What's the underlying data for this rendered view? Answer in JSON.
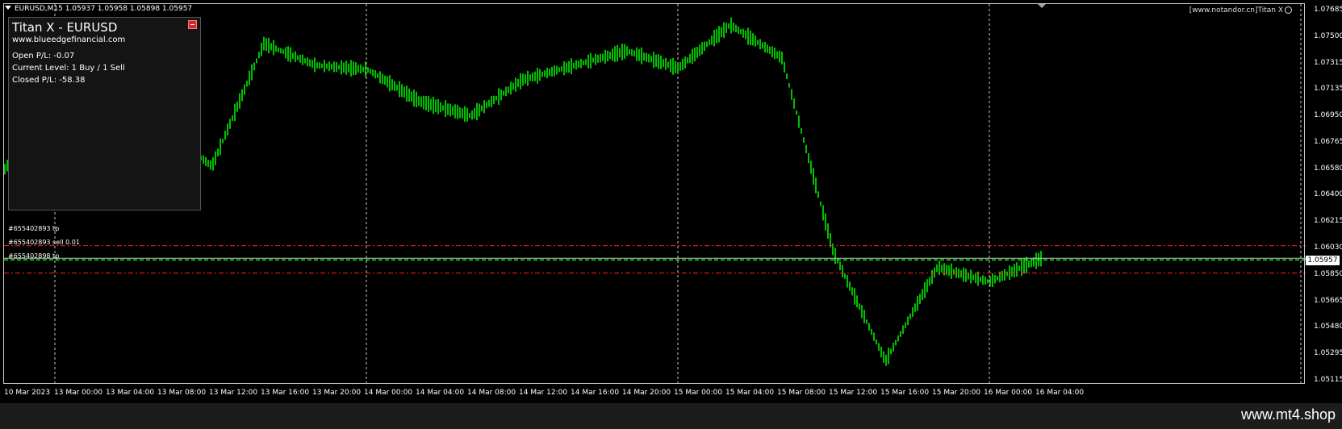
{
  "header": {
    "symbol_line": "EURUSD,M15  1.05937 1.05958 1.05898 1.05957"
  },
  "top_right_label": "[www.notandor.cn]Titan X",
  "panel": {
    "title": "Titan X - EURUSD",
    "website": "www.blueedgefinancial.com",
    "open_pl": "Open P/L: -0.07",
    "current_level": "Current Level: 1 Buy / 1 Sell",
    "closed_pl": "Closed P/L: -58.38"
  },
  "order_labels": {
    "tp_top": "#655402893 tp",
    "entry": "#655402893 sell 0.01",
    "tp_bottom": "#655402898 tp"
  },
  "price_axis": {
    "ticks": [
      "1.07685",
      "1.07500",
      "1.07315",
      "1.07135",
      "1.06950",
      "1.06765",
      "1.06580",
      "1.06400",
      "1.06215",
      "1.06030",
      "1.05850",
      "1.05665",
      "1.05480",
      "1.05295",
      "1.05115"
    ],
    "current_price": "1.05957"
  },
  "time_axis": {
    "ticks": [
      "10 Mar 2023",
      "13 Mar 00:00",
      "13 Mar 04:00",
      "13 Mar 08:00",
      "13 Mar 12:00",
      "13 Mar 16:00",
      "13 Mar 20:00",
      "14 Mar 00:00",
      "14 Mar 04:00",
      "14 Mar 08:00",
      "14 Mar 12:00",
      "14 Mar 16:00",
      "14 Mar 20:00",
      "15 Mar 00:00",
      "15 Mar 04:00",
      "15 Mar 08:00",
      "15 Mar 12:00",
      "15 Mar 16:00",
      "15 Mar 20:00",
      "16 Mar 00:00",
      "16 Mar 04:00"
    ]
  },
  "watermark": "www.mt4.shop",
  "colors": {
    "background": "#000000",
    "candle": "#00ff00",
    "grid": "#c8c8c8",
    "stop_lines": "#ff2020",
    "entry_line": "#00ff00",
    "ask_line": "#c8c8c8"
  },
  "chart_data": {
    "type": "line",
    "symbol": "EURUSD",
    "timeframe": "M15",
    "y_range": [
      1.05115,
      1.07685
    ],
    "series": [
      {
        "x": [
          "10 Mar 2023",
          "13 Mar 00:00",
          "13 Mar 04:00",
          "13 Mar 08:00",
          "13 Mar 12:00",
          "13 Mar 16:00",
          "13 Mar 20:00",
          "14 Mar 00:00",
          "14 Mar 04:00",
          "14 Mar 08:00",
          "14 Mar 12:00",
          "14 Mar 16:00",
          "14 Mar 20:00",
          "15 Mar 00:00",
          "15 Mar 04:00",
          "15 Mar 08:00",
          "15 Mar 12:00",
          "15 Mar 16:00",
          "15 Mar 20:00",
          "16 Mar 00:00",
          "16 Mar 04:00"
        ],
        "values": [
          1.0658,
          1.0712,
          1.069,
          1.0687,
          1.066,
          1.0745,
          1.073,
          1.0727,
          1.0705,
          1.0695,
          1.072,
          1.073,
          1.074,
          1.0728,
          1.0758,
          1.0735,
          1.06,
          1.0525,
          1.059,
          1.058,
          1.0596
        ]
      }
    ],
    "levels": {
      "tp_top": 1.0605,
      "entry": 1.05957,
      "tp_bottom": 1.0586
    }
  }
}
